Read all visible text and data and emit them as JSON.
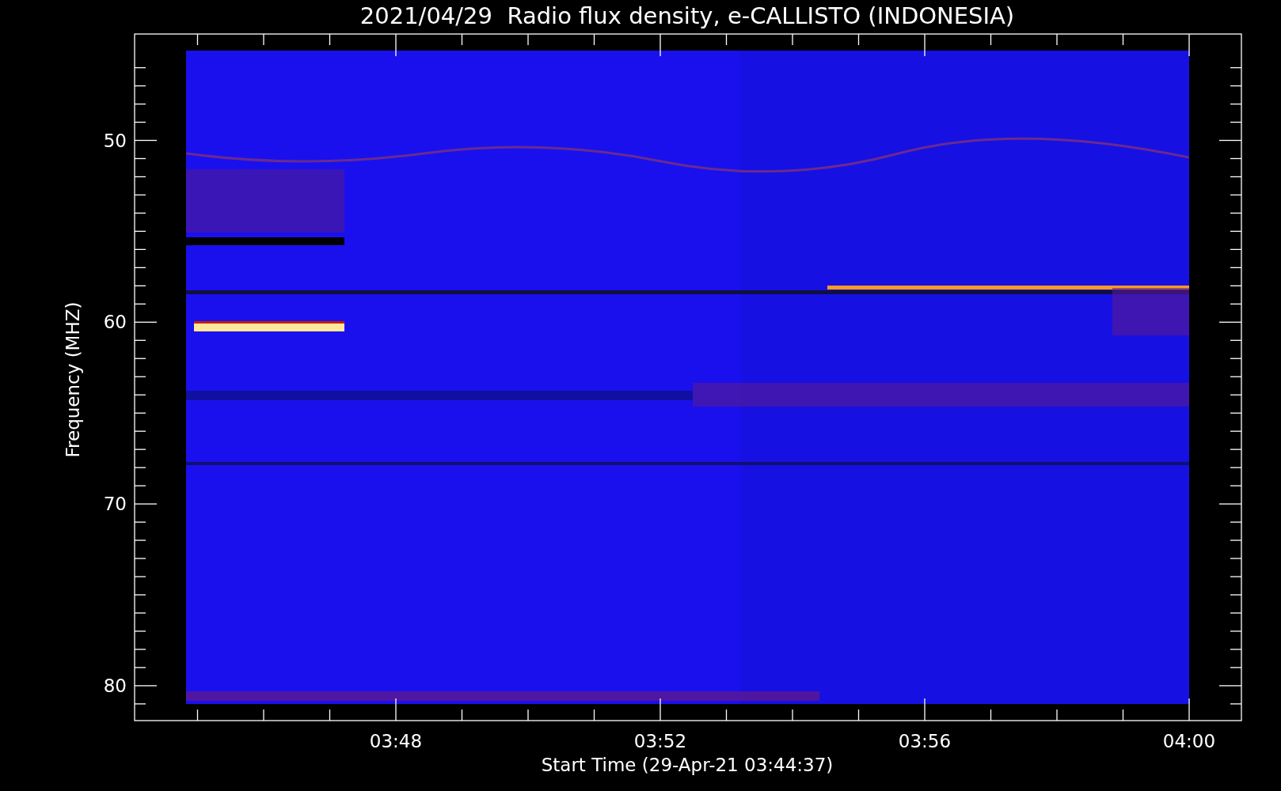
{
  "title": "2021/04/29  Radio flux density, e-CALLISTO (INDONESIA)",
  "y_axis": {
    "label": "Frequency (MHZ)",
    "ticks": [
      "50",
      "60",
      "70",
      "80"
    ]
  },
  "x_axis": {
    "label": "Start Time (29-Apr-21 03:44:37)",
    "ticks": [
      "03:48",
      "03:52",
      "03:56",
      "04:00"
    ]
  }
}
